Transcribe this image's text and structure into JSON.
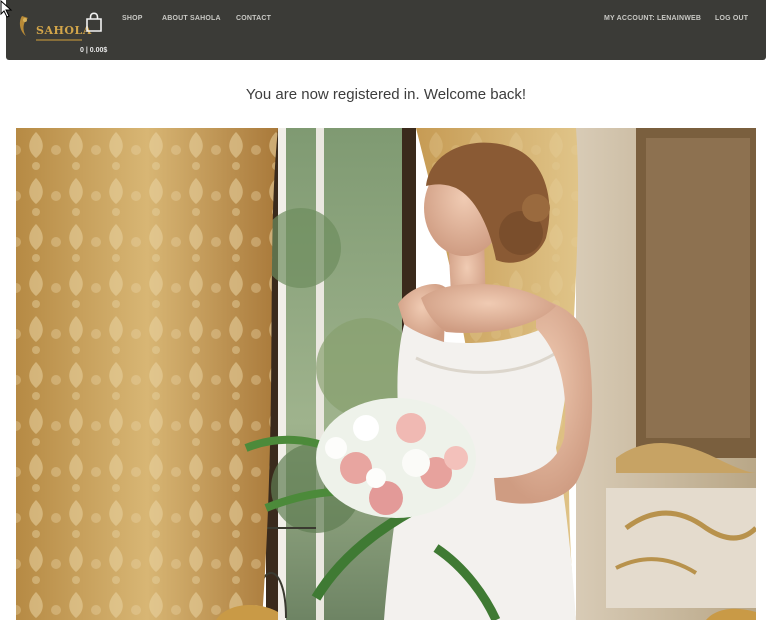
{
  "header": {
    "logo_text": "SAHOLA",
    "cart_total": "0 | 0.00$",
    "nav": {
      "shop": "SHOP",
      "about": "ABOUT SAHOLA",
      "contact": "CONTACT",
      "account": "MY ACCOUNT: LENAINWEB",
      "logout": "LOG OUT"
    }
  },
  "main": {
    "message": "You are now registered in. Welcome back!"
  },
  "colors": {
    "header_bg": "#3b3b37",
    "logo_gold": "#d2a54a",
    "curtain_gold": "#c9a35a"
  }
}
